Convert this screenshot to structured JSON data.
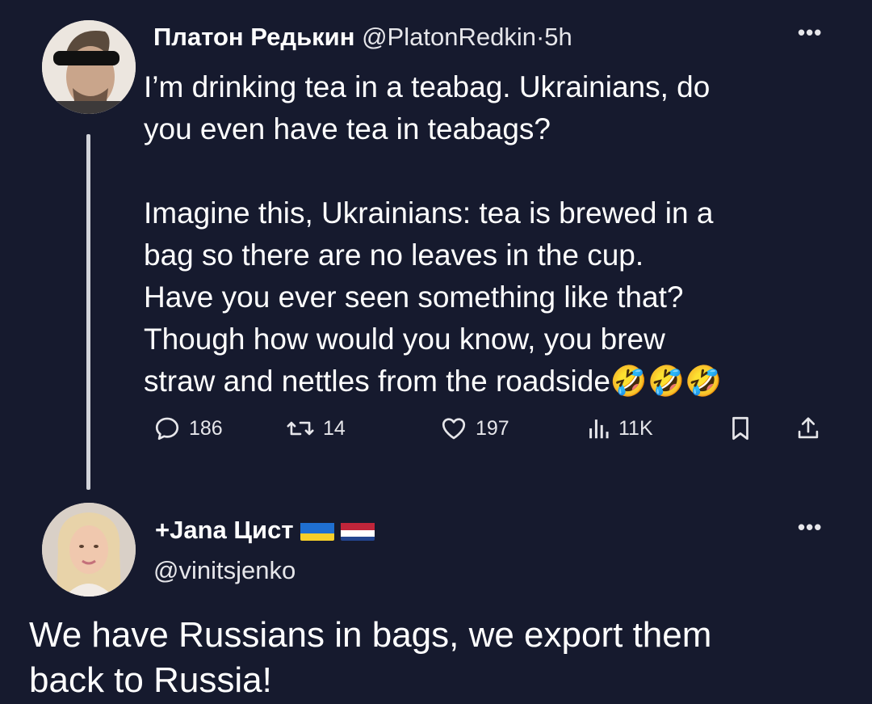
{
  "tweet": {
    "display_name": "Платон Редькин",
    "handle": "@PlatonRedkin",
    "separator": "·",
    "time": "5h",
    "more": "•••",
    "text": "I’m drinking tea in a teabag. Ukrainians, do\nyou even have tea in teabags?\n\nImagine this, Ukrainians: tea is brewed in a\nbag so there are no leaves in the cup.\nHave you ever seen something like that?\nThough how would you know, you brew\nstraw and nettles from the roadside🤣🤣🤣",
    "actions": {
      "reply_count": "186",
      "retweet_count": "14",
      "like_count": "197",
      "views_count": "11K"
    },
    "icons": [
      "reply-icon",
      "retweet-icon",
      "like-icon",
      "views-icon",
      "bookmark-icon",
      "share-icon"
    ]
  },
  "reply": {
    "name_prefix": "+",
    "display_name": "Jana Цист",
    "flags": [
      "ukraine",
      "netherlands"
    ],
    "handle": "@vinitsjenko",
    "more": "•••",
    "text": "We have Russians in bags, we export them\nback to Russia!"
  },
  "colors": {
    "background": "#161a2e",
    "text": "#ffffff",
    "muted": "#e6e6ea"
  }
}
